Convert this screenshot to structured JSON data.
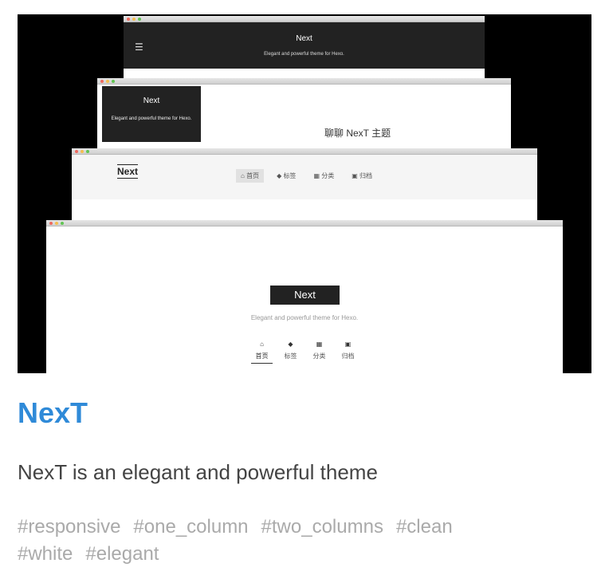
{
  "preview": {
    "window1": {
      "menu_icon": "hamburger-icon",
      "title": "Next",
      "subtitle": "Elegant and powerful theme for Hexo."
    },
    "window2": {
      "sidebar_title": "Next",
      "sidebar_subtitle": "Elegant and powerful theme for Hexo.",
      "post_title": "聊聊 NexT 主题"
    },
    "window3": {
      "logo": "Next",
      "nav": [
        {
          "icon": "home-icon",
          "label": "首页"
        },
        {
          "icon": "tag-icon",
          "label": "标签"
        },
        {
          "icon": "grid-icon",
          "label": "分类"
        },
        {
          "icon": "archive-icon",
          "label": "归档"
        }
      ]
    },
    "window4": {
      "title": "Next",
      "subtitle": "Elegant and powerful theme for Hexo.",
      "nav": [
        {
          "icon": "home-icon",
          "label": "首页"
        },
        {
          "icon": "tag-icon",
          "label": "标签"
        },
        {
          "icon": "grid-icon",
          "label": "分类"
        },
        {
          "icon": "archive-icon",
          "label": "归档"
        }
      ]
    }
  },
  "theme": {
    "name": "NexT",
    "description": "NexT is an elegant and powerful theme",
    "tags": [
      "#responsive",
      "#one_column",
      "#two_columns",
      "#clean",
      "#white",
      "#elegant"
    ]
  },
  "colors": {
    "title": "#2f8ad8",
    "text": "#444444",
    "tags": "#aaaaaa"
  }
}
